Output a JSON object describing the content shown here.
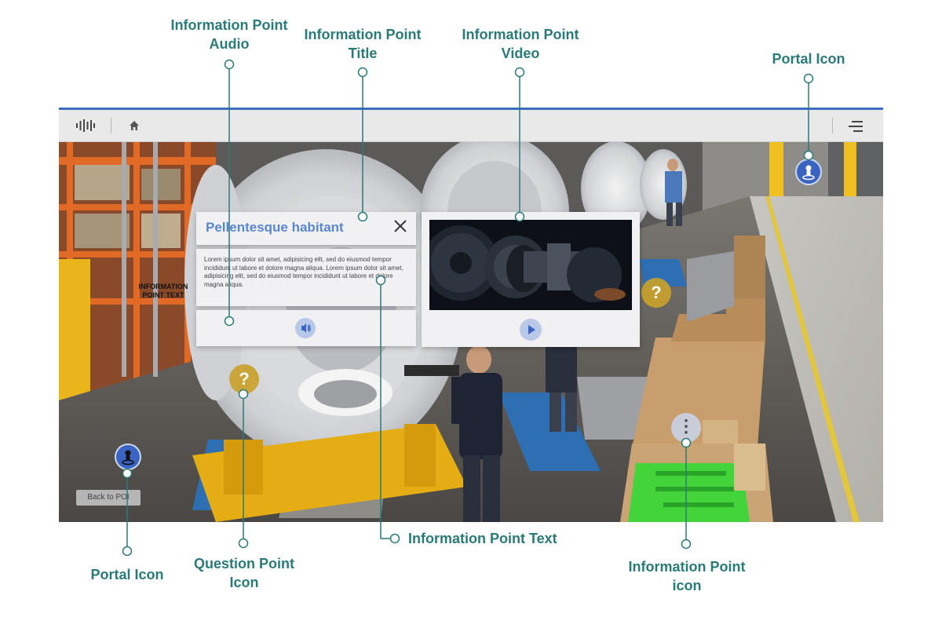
{
  "callouts": {
    "audio": [
      "Information Point",
      "Audio"
    ],
    "title": [
      "Information Point",
      "Title"
    ],
    "video": [
      "Information Point",
      "Video"
    ],
    "portal_top": "Portal Icon",
    "portal_bottom": "Portal Icon",
    "question": [
      "Question Point",
      "Icon"
    ],
    "text": "Information Point Text",
    "info_icon": [
      "Information Point",
      "icon"
    ]
  },
  "toolbar": {
    "logo_icon": "soundwave-logo-icon",
    "home_icon": "home-icon",
    "menu_icon": "hamburger-menu-icon",
    "accent_color": "#3b6fc1"
  },
  "info_point": {
    "title": "Pellentesque habitant",
    "close_icon": "close-icon",
    "body": "Lorem ipsum dolor sit amet, adipisicing elit, sed do eiusmod tempor incididunt ut labore et dolore magna aliqua. Lorem ipsum dolor sit amet, adipisicing elit, sed do eiusmod tempor incididunt ut labore et dolore magna aliqua.",
    "audio_icon": "speaker-icon",
    "play_icon": "play-icon",
    "title_color": "#5a86d0"
  },
  "scene": {
    "label": [
      "INFORMATION",
      "POINT TEXT"
    ],
    "back_button": "Back to POI",
    "question_symbol": "?",
    "info_symbol": "⋮",
    "portal_icon": "person-pin-icon"
  },
  "colors": {
    "callout": "#2a7a78",
    "question_point": "#c9a22c",
    "portal": "#3a63c2"
  }
}
